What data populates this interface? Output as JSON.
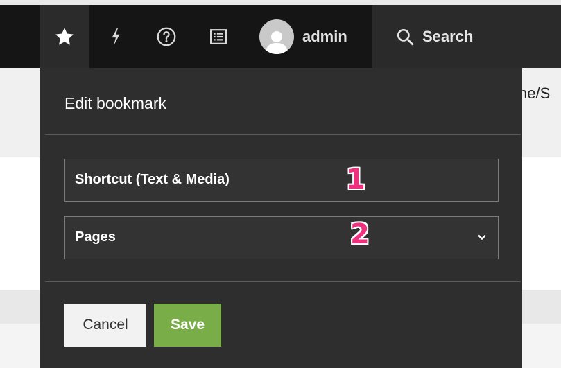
{
  "toolbar": {
    "username": "admin",
    "search_label": "Search",
    "icons": [
      "star-icon",
      "flash-icon",
      "help-icon",
      "list-icon",
      "user-avatar",
      "search-icon"
    ]
  },
  "background": {
    "path_fragment": "ne/S"
  },
  "panel": {
    "title": "Edit bookmark",
    "bookmark_title_value": "Shortcut (Text & Media)",
    "group_select_value": "Pages",
    "cancel_label": "Cancel",
    "save_label": "Save"
  },
  "annotations": [
    "1",
    "2"
  ],
  "colors": {
    "toolbar_bg": "#151515",
    "panel_bg": "#2e2e2e",
    "save_green": "#79ad47",
    "annotation_pink": "#f0307e"
  }
}
